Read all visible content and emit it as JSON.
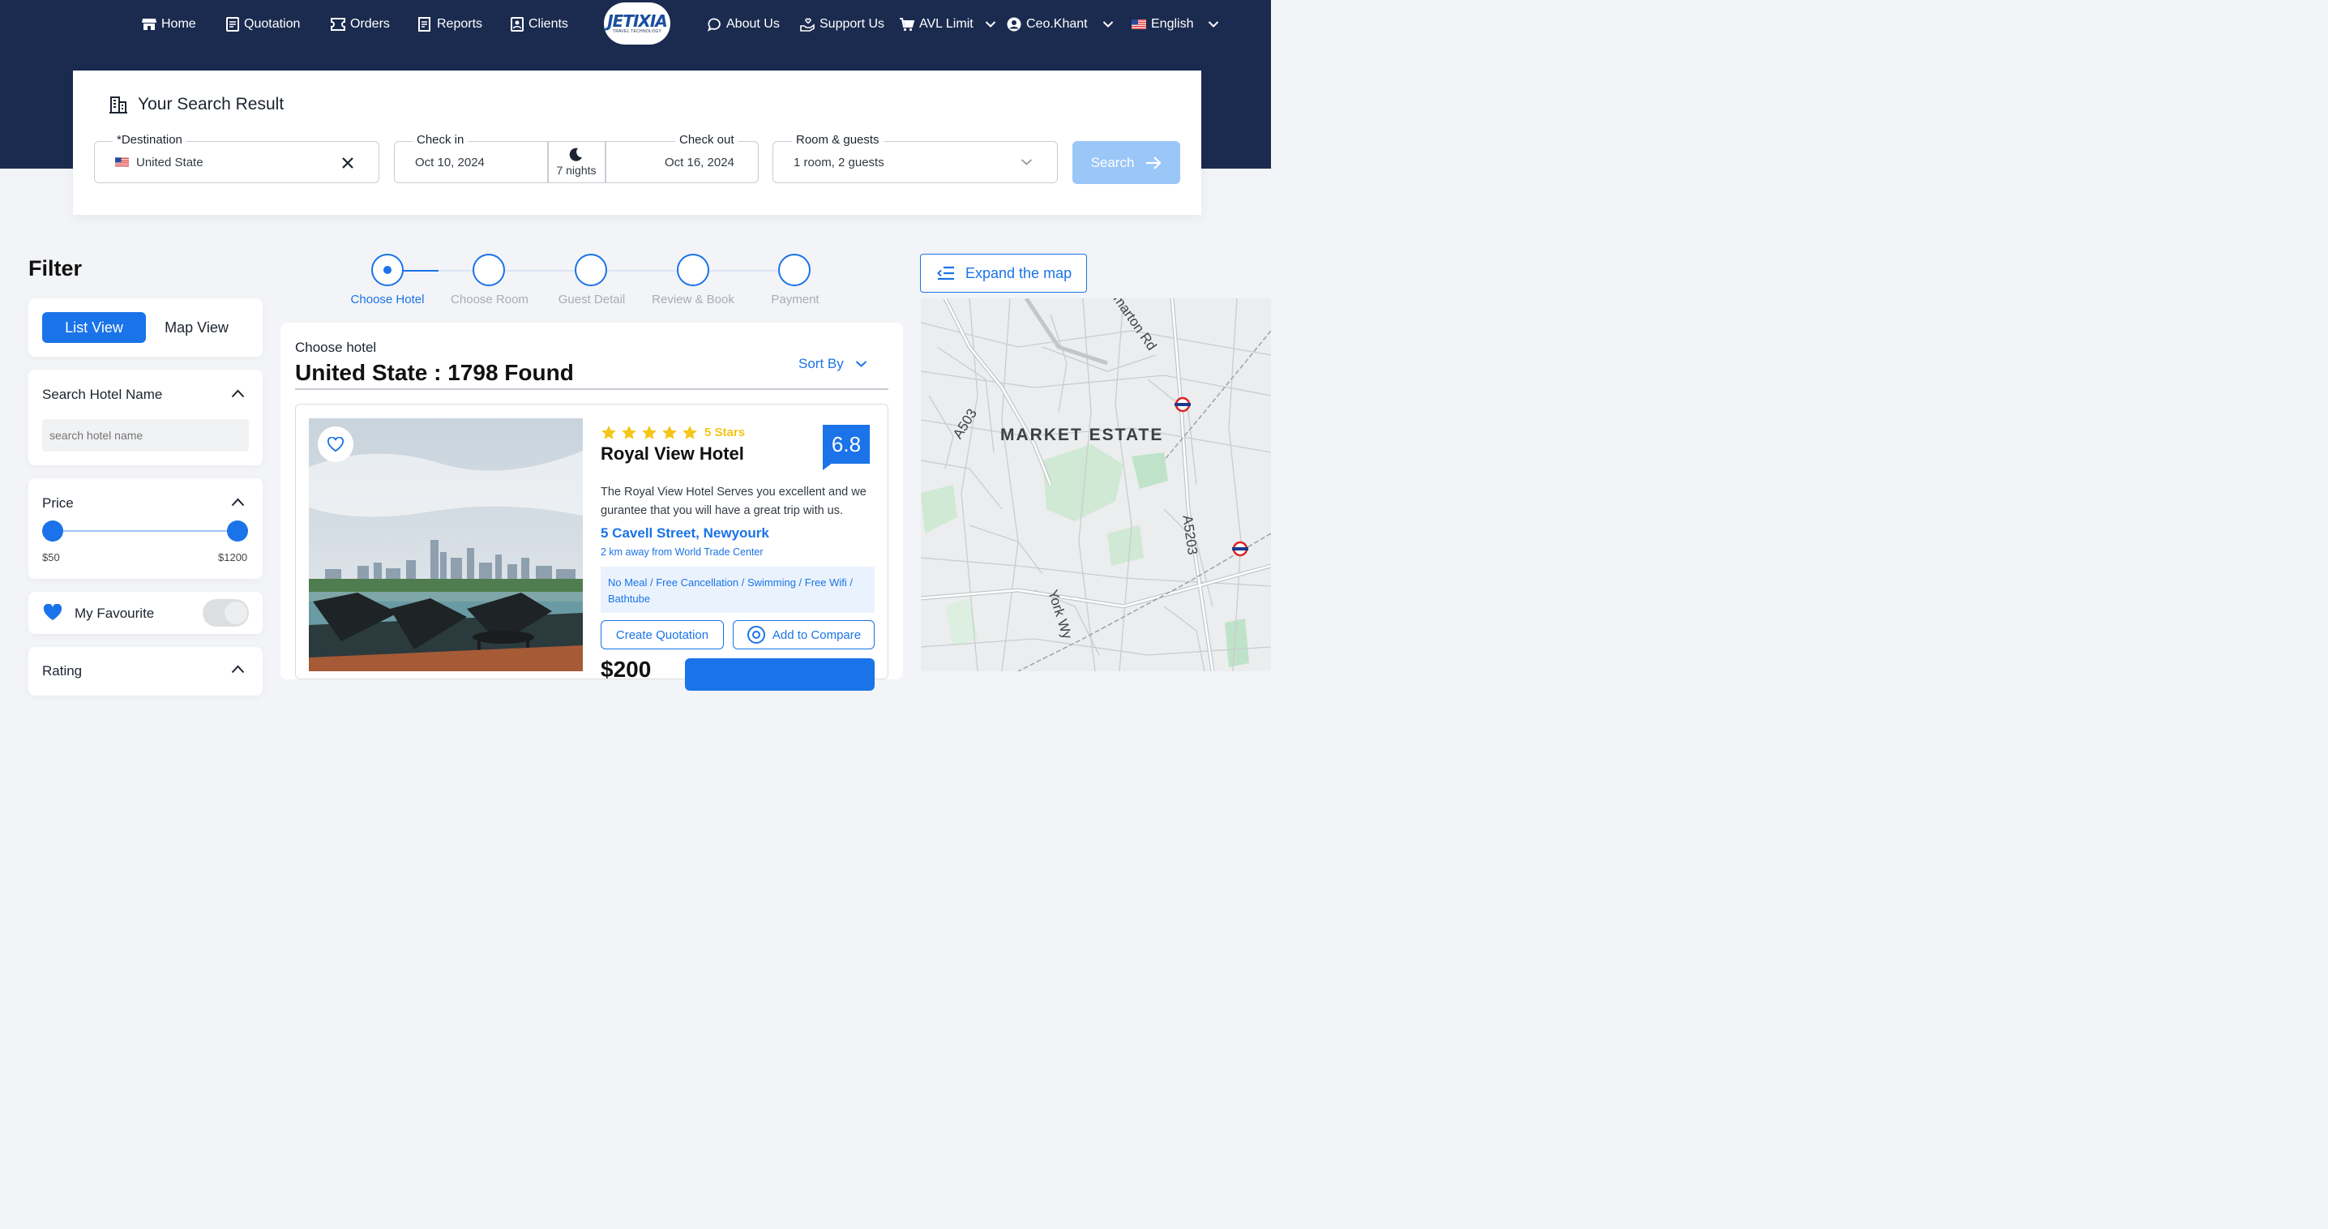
{
  "nav": {
    "home": "Home",
    "quotation": "Quotation",
    "orders": "Orders",
    "reports": "Reports",
    "clients": "Clients",
    "logo_text": "JETIXIA",
    "logo_sub": "TRAVEL TECHNOLOGY",
    "about": "About Us",
    "support": "Support Us",
    "avl_limit": "AVL Limit",
    "user": "Ceo.Khant",
    "language": "English"
  },
  "search": {
    "title": "Your Search Result",
    "destination_label": "*Destination",
    "destination_value": "United State",
    "checkin_label": "Check in",
    "checkin_value": "Oct 10, 2024",
    "nights": "7 nights",
    "checkout_label": "Check out",
    "checkout_value": "Oct 16, 2024",
    "rooms_label": "Room & guests",
    "rooms_value": "1 room, 2 guests",
    "search_button": "Search"
  },
  "filter": {
    "title": "Filter",
    "list_view": "List View",
    "map_view": "Map View",
    "hotel_name_title": "Search Hotel Name",
    "hotel_name_placeholder": "search hotel name",
    "price_title": "Price",
    "price_min": "$50",
    "price_max": "$1200",
    "price_range_fraction": [
      0,
      1
    ],
    "favourite_label": "My Favourite",
    "favourite_on": false,
    "rating_title": "Rating"
  },
  "steps": [
    {
      "label": "Choose Hotel",
      "active": true
    },
    {
      "label": "Choose Room",
      "active": false
    },
    {
      "label": "Guest Detail",
      "active": false
    },
    {
      "label": "Review & Book",
      "active": false
    },
    {
      "label": "Payment",
      "active": false
    }
  ],
  "results": {
    "subtitle": "Choose hotel",
    "heading": "United State : 1798 Found",
    "sort_by": "Sort By"
  },
  "hotel": {
    "stars": 5,
    "stars_label": "5 Stars",
    "name": "Royal View Hotel",
    "score": "6.8",
    "description": "The Royal View Hotel Serves you excellent and we gurantee that you will have a great trip with us.",
    "address": "5 Cavell Street, Newyourk",
    "distance": "2 km away from World Trade Center",
    "amenities": "No Meal / Free Cancellation / Swimming / Free Wifi / Bathtube",
    "create_quotation": "Create Quotation",
    "add_compare": "Add to Compare",
    "price": "$200"
  },
  "map": {
    "expand_button": "Expand the map",
    "labels": {
      "area": "MARKET ESTATE",
      "road_a503": "A503",
      "road_a5203": "A5203",
      "road_york": "York Wy",
      "road_rd": "marton Rd"
    }
  },
  "colors": {
    "header": "#1b2b4f",
    "accent": "#1a73e8",
    "search_btn": "#9ac6f8",
    "star": "#f5c518"
  }
}
